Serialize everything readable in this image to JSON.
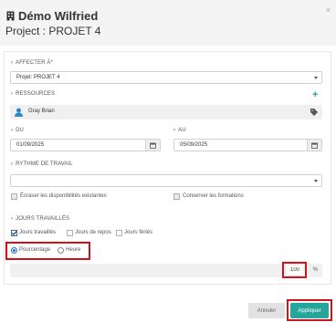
{
  "header": {
    "title": "Démo Wilfried",
    "subtitle": "Project : PROJET 4",
    "close_label": "×"
  },
  "affecter": {
    "label": "AFFECTER À*",
    "value": "Projet: PROJET 4"
  },
  "ressources": {
    "label": "RESSOURCES",
    "add_label": "+",
    "person": "Gray Brian"
  },
  "dates": {
    "du_label": "DU",
    "du_value": "01/09/2025",
    "au_label": "AU",
    "au_value": "05/09/2025"
  },
  "rythme": {
    "label": "RYTHME DE TRAVAIL",
    "value": ""
  },
  "options": {
    "ecraser": "Écraser les disponibilités existantes",
    "conserver": "Conserver les formations"
  },
  "jours": {
    "label": "JOURS TRAVAILLÉS",
    "travailles": "Jours travaillés",
    "repos": "Jours de repos",
    "feries": "Jours fériés"
  },
  "mode": {
    "pourcentage": "Pourcentage",
    "heure": "Heure",
    "value": "100",
    "unit": "%"
  },
  "footer": {
    "cancel": "Annuler",
    "apply": "Appliquer"
  },
  "colors": {
    "accent": "#2a8bc0",
    "apply": "#26a69a",
    "highlight": "#d0121a"
  }
}
